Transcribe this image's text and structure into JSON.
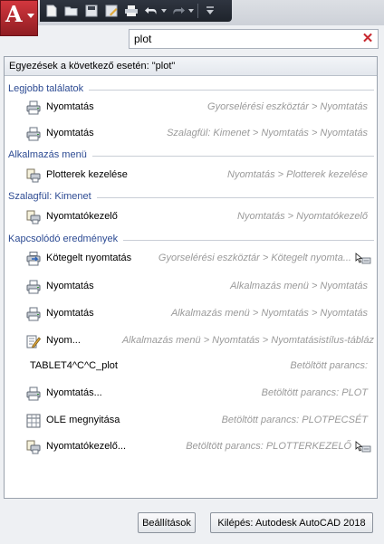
{
  "search": {
    "value": "plot"
  },
  "panel": {
    "header": "Egyezések a következő esetén: \"plot\""
  },
  "categories": {
    "best": "Legjobb találatok",
    "appmenu": "Alkalmazás menü",
    "ribbon": "Szalagfül: Kimenet",
    "related": "Kapcsolódó eredmények"
  },
  "rows": [
    {
      "label": "Nyomtatás",
      "path": "Gyorselérési eszköztár > Nyomtatás",
      "icon": "printer-icon"
    },
    {
      "label": "Nyomtatás",
      "path": "Szalagfül: Kimenet > Nyomtatás > Nyomtatás",
      "icon": "printer-icon"
    },
    {
      "label": "Plotterek kezelése",
      "path": "Nyomtatás > Plotterek kezelése",
      "icon": "plotter-manager-icon"
    },
    {
      "label": "Nyomtatókezelő",
      "path": "Nyomtatás > Nyomtatókezelő",
      "icon": "plotter-manager-icon"
    },
    {
      "label": "Kötegelt nyomtatás",
      "path": "Gyorselérési eszköztár > Kötegelt nyomta...",
      "icon": "batch-plot-icon"
    },
    {
      "label": "Nyomtatás",
      "path": "Alkalmazás menü > Nyomtatás",
      "icon": "printer-icon"
    },
    {
      "label": "Nyomtatás",
      "path": "Alkalmazás menü > Nyomtatás > Nyomtatás",
      "icon": "printer-icon"
    },
    {
      "label": "Nyom...",
      "path": "Alkalmazás menü > Nyomtatás > Nyomtatásistílus-tábláz",
      "icon": "plot-style-edit-icon"
    },
    {
      "label": "TABLET4^C^C_plot",
      "path": "Betöltött parancs:",
      "icon": ""
    },
    {
      "label": "Nyomtatás...",
      "path": "Betöltött parancs: PLOT",
      "icon": "printer-icon"
    },
    {
      "label": "OLE megnyitása",
      "path": "Betöltött parancs: PLOTPECSÉT",
      "icon": "ole-table-icon"
    },
    {
      "label": "Nyomtatókezelő...",
      "path": "Betöltött parancs: PLOTTERKEZELŐ",
      "icon": "plotter-manager-icon"
    }
  ],
  "buttons": {
    "options": "Beállítások",
    "exit": "Kilépés: Autodesk AutoCAD 2018"
  }
}
